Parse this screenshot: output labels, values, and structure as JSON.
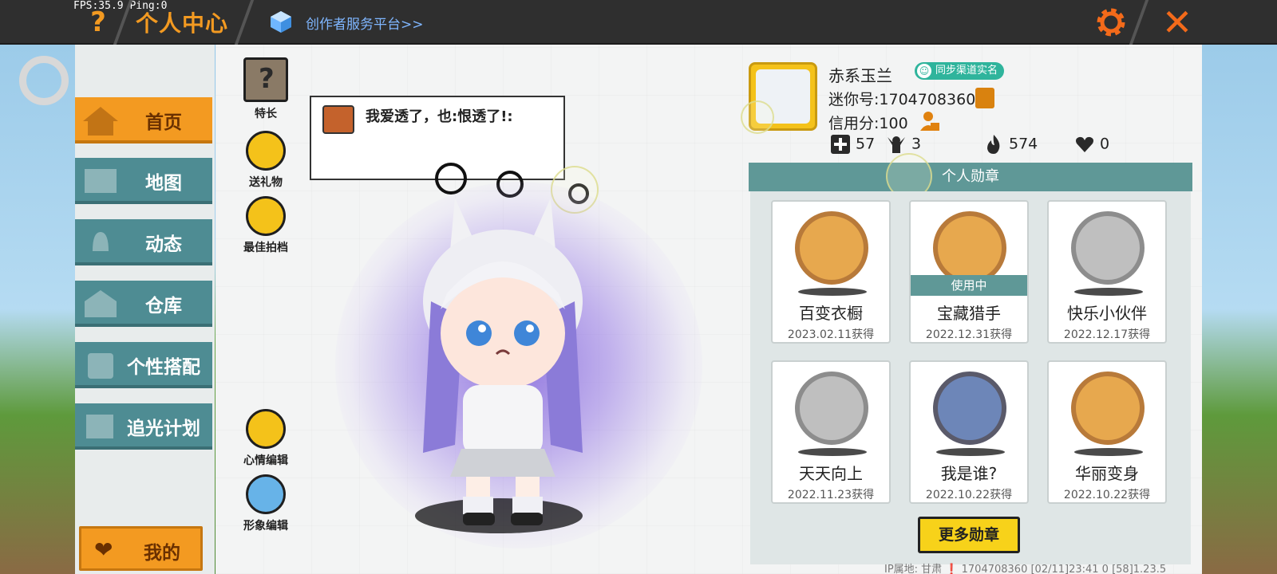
{
  "hud": {
    "fps": "FPS:35.9  Ping:0"
  },
  "header": {
    "help_symbol": "?",
    "title": "个人中心",
    "creator_link": "创作者服务平台>>",
    "close_symbol": "✕"
  },
  "sidebar": {
    "items": [
      {
        "label": "首页",
        "active": true
      },
      {
        "label": "地图"
      },
      {
        "label": "动态"
      },
      {
        "label": "仓库"
      },
      {
        "label": "个性搭配"
      },
      {
        "label": "追光计划"
      }
    ],
    "mine_label": "我的"
  },
  "quick_actions": {
    "talent": "特长",
    "gift": "送礼物",
    "best_photo": "最佳拍档",
    "mood_edit": "心情编辑",
    "avatar_edit": "形象编辑"
  },
  "bubble": {
    "text": "我爱透了，也:恨透了!:"
  },
  "profile": {
    "name": "赤系玉兰",
    "sync_badge": "同步渠道实名",
    "mini_id": "迷你号:1704708360",
    "credit": "信用分:100",
    "stats": {
      "posts": "57",
      "fans": "3",
      "popularity": "574",
      "likes": "0"
    }
  },
  "medals": {
    "header": "个人勋章",
    "in_use_label": "使用中",
    "items": [
      {
        "name": "百变衣橱",
        "date": "2023.02.11获得"
      },
      {
        "name": "宝藏猎手",
        "date": "2022.12.31获得"
      },
      {
        "name": "快乐小伙伴",
        "date": "2022.12.17获得"
      },
      {
        "name": "天天向上",
        "date": "2022.11.23获得"
      },
      {
        "name": "我是谁?",
        "date": "2022.10.22获得"
      },
      {
        "name": "华丽变身",
        "date": "2022.10.22获得"
      }
    ],
    "more_button": "更多勋章"
  },
  "footer": {
    "info": "IP属地: 甘肃 ❗   1704708360   [02/11]23:41 0  [58]1.23.5"
  }
}
